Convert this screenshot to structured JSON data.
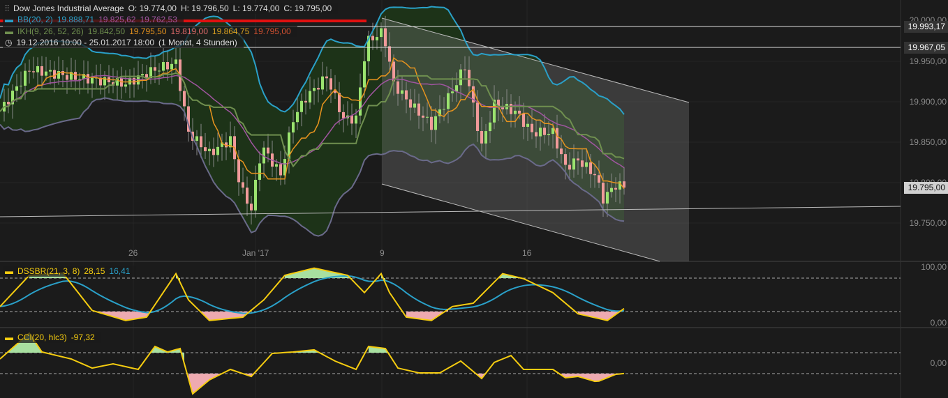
{
  "header": {
    "instrument": "Dow Jones Industrial Average",
    "open": "O: 19.774,00",
    "high": "H: 19.796,50",
    "low": "L: 19.774,00",
    "close": "C: 19.795,00",
    "bb_label": "BB(20, 2)",
    "bb_values": [
      "19.888,71",
      "19.825,62",
      "19.762,53"
    ],
    "ikh_label": "IKH(9, 26, 52, 26)",
    "ikh_values": [
      "19.842,50",
      "19.795,50",
      "19.819,00",
      "19.864,75",
      "19.795,00"
    ],
    "range": "19.12.2016 10:00 - 25.01.2017 18:00",
    "period": "(1 Monat, 4 Stunden)"
  },
  "price_axis": {
    "ticks": [
      "20.000,00",
      "19.950,00",
      "19.900,00",
      "19.850,00",
      "19.800,00",
      "19.750,00"
    ],
    "tags": {
      "upper": "19.993,17",
      "lower": "19.967,05",
      "last": "19.795,00"
    }
  },
  "time_axis": [
    "26",
    "Jan '17",
    "9",
    "16"
  ],
  "dss": {
    "label": "DSSBR(21, 3, 8)",
    "value": "28,15",
    "signal": "16,41",
    "ticks": [
      "100,00",
      "0,00"
    ]
  },
  "cci": {
    "label": "CCI(20, hlc3)",
    "value": "-97,32",
    "ticks": [
      "0,00"
    ]
  },
  "colors": {
    "up": "#9be36f",
    "down": "#f09a9a",
    "bb": "#2aa0c8",
    "bbmid": "#a055a0",
    "ikh": "#6f8f4f",
    "tenkan": "#e8941e",
    "dss": "#f5cc10",
    "cci": "#f5cc10"
  },
  "chart_data": {
    "type": "candlestick",
    "bars": [
      0,
      7,
      17,
      30,
      37,
      42,
      45,
      50,
      55,
      57.5,
      60,
      62.5,
      67,
      70,
      73,
      78,
      82,
      85,
      87.5,
      91.5,
      94,
      98,
      103,
      108,
      111,
      115,
      118,
      123,
      127,
      132,
      135,
      138,
      142,
      144,
      147,
      149.5
    ],
    "closes": [
      19888,
      19940,
      19931,
      19922,
      19940,
      19948,
      19862,
      19836,
      19853,
      19793,
      19767,
      19845,
      19810,
      19879,
      19905,
      19931,
      19879,
      19879,
      19974,
      19987,
      19922,
      19897,
      19871,
      19914,
      19944,
      19845,
      19897,
      19888,
      19862,
      19862,
      19819,
      19828,
      19810,
      19780,
      19797,
      19795
    ],
    "dss_bars": [
      0,
      7,
      15,
      22,
      30,
      35,
      42,
      45,
      50,
      58,
      63,
      68,
      75,
      83,
      87,
      91,
      93,
      97,
      103,
      108,
      113,
      120,
      125,
      132,
      138,
      145,
      149.5
    ],
    "dss": [
      29,
      85,
      89,
      22,
      4,
      10,
      88,
      41,
      4,
      10,
      41,
      85,
      98,
      85,
      54,
      88,
      54,
      10,
      4,
      29,
      35,
      88,
      79,
      54,
      16,
      4,
      28.15
    ],
    "cci_bars": [
      0,
      7,
      10,
      17,
      22,
      27,
      33,
      37,
      40,
      43,
      46,
      50,
      55,
      60,
      65,
      70,
      75,
      80,
      85,
      88,
      92,
      95,
      100,
      105,
      110,
      115,
      118,
      122,
      125,
      132,
      135,
      138,
      142.5,
      147,
      149.5
    ],
    "cci": [
      40,
      287,
      107,
      40,
      -47,
      -7,
      -60,
      160,
      107,
      140,
      -293,
      -160,
      -60,
      -127,
      93,
      107,
      127,
      20,
      -60,
      160,
      140,
      -47,
      -93,
      -93,
      20,
      -147,
      7,
      73,
      -60,
      -60,
      -140,
      -127,
      -180,
      -107,
      -97.32
    ]
  }
}
